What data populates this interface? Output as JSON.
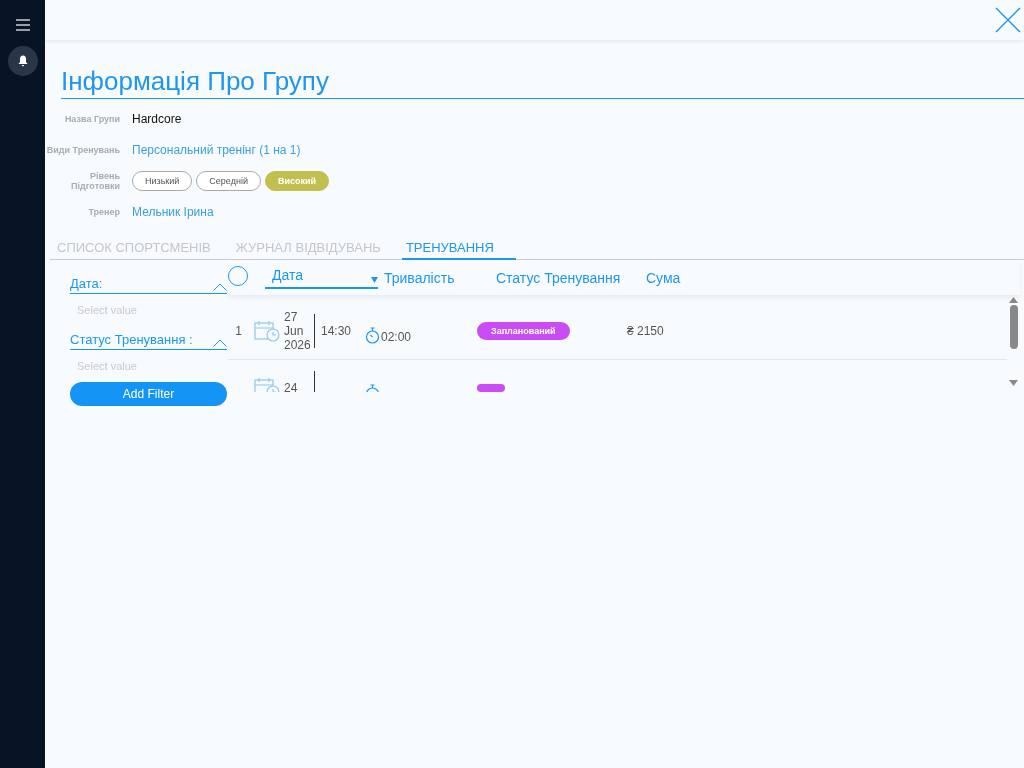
{
  "title": "Інформація Про Групу",
  "fields": [
    {
      "label": "Назва Групи",
      "value": "Hardcore",
      "kind": "text"
    },
    {
      "label": "Види Тренувань",
      "value": "Персональний тренінг (1 на 1)",
      "kind": "link"
    },
    {
      "label": "Рівень Підготовки",
      "kind": "levels",
      "options": [
        {
          "label": "Низький",
          "selected": false
        },
        {
          "label": "Середній",
          "selected": false
        },
        {
          "label": "Високий",
          "selected": true
        }
      ]
    },
    {
      "label": "Тренер",
      "value": "Мельник Ірина",
      "kind": "link"
    }
  ],
  "tabs": [
    {
      "label": "СПИСОК СПОРТСМЕНІВ",
      "selected": false
    },
    {
      "label": "ЖУРНАЛ ВІДВІДУВАНЬ",
      "selected": false
    },
    {
      "label": "ТРЕНУВАННЯ",
      "selected": true
    }
  ],
  "filters": [
    {
      "label": "Дата:",
      "placeholder": "Select value"
    },
    {
      "label": "Статус Тренування :",
      "placeholder": "Select value"
    }
  ],
  "add_filter": "Add Filter",
  "table": {
    "all_selected": false,
    "columns": [
      "Дата",
      "Тривалість",
      "Статус Тренування",
      "Сума"
    ],
    "rows": [
      {
        "index": "1",
        "day": "27",
        "month": "Jun",
        "year": "2026",
        "time": "14:30",
        "duration": "02:00",
        "status": "Запланований",
        "sum": "₴ 2150"
      },
      {
        "day": "24"
      }
    ]
  }
}
